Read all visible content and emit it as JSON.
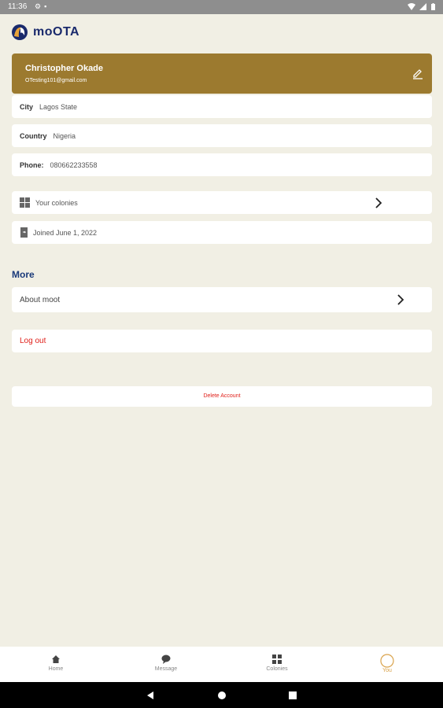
{
  "status_bar": {
    "time": "11:36"
  },
  "app": {
    "name": "moOTA"
  },
  "profile": {
    "name": "Christopher Okade",
    "email": "OTesting101@gmail.com"
  },
  "details": [
    {
      "label": "City",
      "value": "Lagos State"
    },
    {
      "label": "Country",
      "value": "Nigeria"
    },
    {
      "label": "Phone:",
      "value": "080662233558"
    }
  ],
  "colonies_link": {
    "label": "Your colonies",
    "icon": "grid-icon"
  },
  "joined": {
    "text": "Joined June 1, 2022",
    "icon": "calendar-icon"
  },
  "more": {
    "title": "More",
    "about_label": "About moot",
    "logout_label": "Log out",
    "delete_label": "Delete Account"
  },
  "bottom_nav": {
    "items": [
      {
        "label": "Home",
        "icon": "home-icon"
      },
      {
        "label": "Message",
        "icon": "message-icon"
      },
      {
        "label": "Colonies",
        "icon": "grid-icon"
      },
      {
        "label": "You",
        "icon": "profile-icon"
      }
    ],
    "active_color": "#d9a24a"
  },
  "colors": {
    "header_card": "#9c7a2f",
    "danger": "#e0201a",
    "background": "#f1efe4",
    "brand": "#1a2a6c"
  }
}
